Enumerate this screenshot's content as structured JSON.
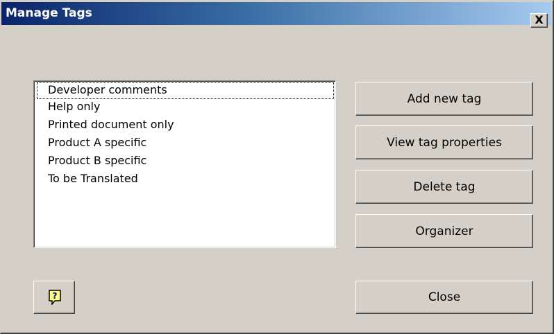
{
  "window": {
    "title": "Manage Tags",
    "close_label": "X"
  },
  "tags": {
    "items": [
      "Developer comments",
      "Help only",
      "Printed document only",
      "Product A specific",
      "Product B specific",
      "To be Translated"
    ],
    "focused_item": "Developer comments"
  },
  "buttons": {
    "add_new_tag": "Add new tag",
    "view_tag_properties": "View tag properties",
    "delete_tag": "Delete tag",
    "organizer": "Organizer",
    "close": "Close"
  },
  "help": {
    "icon": "help-icon"
  },
  "colors": {
    "dialog_face": "#d4d0c8",
    "title_gradient_start": "#0a246a",
    "title_gradient_end": "#a6caf0",
    "title_text": "#ffffff"
  }
}
